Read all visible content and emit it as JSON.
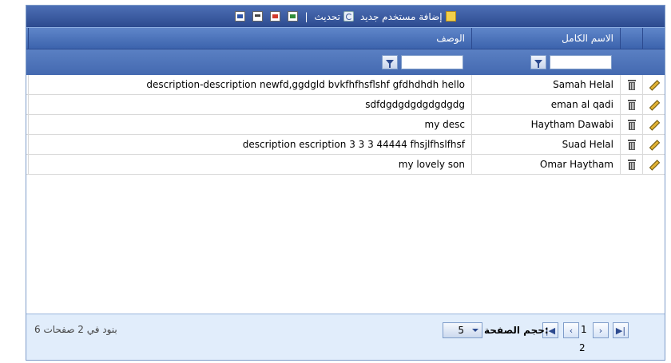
{
  "toolbar": {
    "add_label": "إضافة مستخدم جديد",
    "refresh_label": "تحديث",
    "separator": "|",
    "exports": [
      "export-excel",
      "export-pdf",
      "export-csv",
      "export-word"
    ]
  },
  "columns": {
    "name": "الاسم الكامل",
    "desc": "الوصف"
  },
  "rows": [
    {
      "name": "Samah Helal",
      "desc": "description-description newfd,ggdgld bvkfhfhsflshf gfdhdhdh hello"
    },
    {
      "name": "eman al qadi",
      "desc": "sdfdgdgdgdgdgdgdg"
    },
    {
      "name": "Haytham Dawabi",
      "desc": "my desc"
    },
    {
      "name": "Suad Helal",
      "desc": "description escription 3 3 3 44444 fhsjlfhslfhsf"
    },
    {
      "name": "Omar Haytham",
      "desc": "my lovely son"
    }
  ],
  "pager": {
    "page_1": "1",
    "page_2": "2",
    "size_label": "حجم الصفحة:",
    "size_value": "5",
    "info": "6 بنود في 2 صفحات"
  },
  "colors": {
    "header": "#3c63ad",
    "pager_bg": "#e1edfb"
  }
}
